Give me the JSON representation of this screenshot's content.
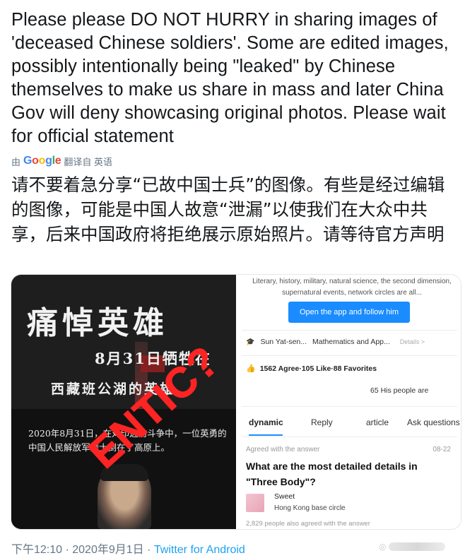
{
  "tweet": {
    "text": "Please please DO NOT HURRY in sharing images of 'deceased Chinese soldiers'.  Some are edited images, possibly intentionally being \"leaked\" by Chinese themselves to make us share in mass and later China Gov will deny showcasing original photos. Please wait for official statement",
    "translate_prefix": "由",
    "translate_brand": [
      "G",
      "o",
      "o",
      "g",
      "l",
      "e"
    ],
    "translate_suffix": "翻译自 英语",
    "translated_text": "请不要着急分享“已故中国士兵”的图像。有些是经过编辑的图像，可能是中国人故意“泄漏”以使我们在大众中共享，后来中国政府将拒绝展示原始照片。请等待官方声明"
  },
  "left_image": {
    "title": "痛悼英雄",
    "subtitle_1": "8月31日牺牲在",
    "subtitle_2": "西藏班公湖的英雄",
    "body": "2020年8月31日，在对印边防斗争中，一位英勇的中国人民解放军战士倒在了高原上。",
    "stamp": "ENTIC?"
  },
  "right_image": {
    "intro": "Literary, history, military, natural science, the second dimension, supernatural events, network circles are all...",
    "follow_button": "Open the app and follow him",
    "school": "Sun Yat-sen...",
    "field": "Mathematics and App...",
    "details": "Details >",
    "agree_stats": "1562 Agree·105 Like·88 Favorites",
    "people": "65 His people are",
    "tabs": [
      "dynamic",
      "Reply",
      "article",
      "Ask questions"
    ],
    "agreed_label": "Agreed with the answer",
    "date": "08-22",
    "question": "What are the most detailed details in \"Three Body\"?",
    "user_name": "Sweet",
    "user_circle": "Hong Kong base circle",
    "also_agreed": "2,829 people also agreed with the answer"
  },
  "footer": {
    "time": "下午12:10 · 2020年9月1日 · ",
    "source": "Twitter for Android"
  },
  "colors": {
    "text": "#14171a",
    "meta": "#657786",
    "link": "#1da1f2",
    "stamp_red": "#ff2424",
    "app_blue": "#1a8cff"
  }
}
